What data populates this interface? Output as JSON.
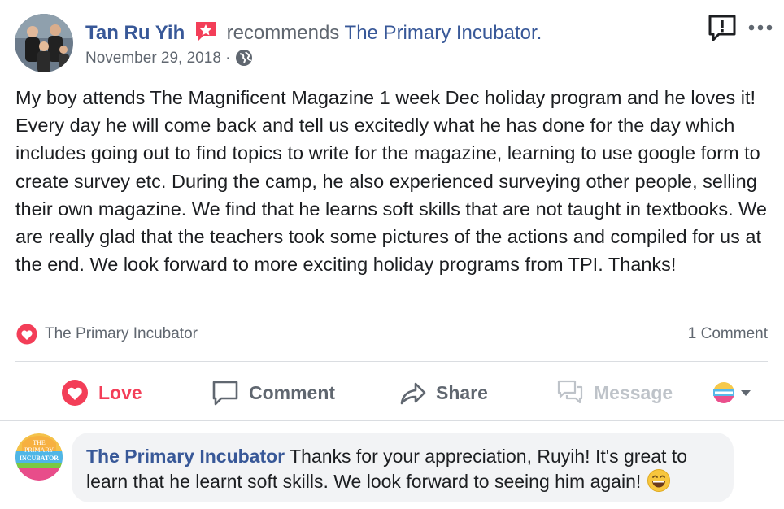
{
  "post": {
    "author_name": "Tan Ru Yih",
    "verb": "recommends",
    "page_name": "The Primary Incubator.",
    "date": "November 29, 2018",
    "date_separator": "·",
    "body": "My boy attends The Magnificent Magazine 1 week Dec holiday program and he loves it! Every day he will come back and tell us excitedly what he has done for the day which includes going out to find topics to write for the magazine, learning to use google form to create survey etc. During the camp, he also experienced surveying other people, selling their own magazine. We find that he learns soft skills that are not taught in textbooks. We are really glad that the teachers took some pictures of the actions and compiled for us at the end. We look forward to more exciting holiday programs from TPI. Thanks!"
  },
  "reactions": {
    "reactor": "The Primary Incubator",
    "comment_count": "1 Comment"
  },
  "actions": {
    "love": "Love",
    "comment": "Comment",
    "share": "Share",
    "message": "Message"
  },
  "comment": {
    "author": "The Primary Incubator",
    "text": " Thanks for your appreciation, Ruyih! It's great to learn that he learnt soft skills. We look forward to seeing him again! ",
    "avatar_text": [
      "THE",
      "PRIMARY",
      "INCUBATOR"
    ]
  },
  "colors": {
    "link_blue": "#385898",
    "love_red": "#f33e58",
    "muted": "#606770",
    "bubble_bg": "#f2f3f5"
  },
  "icons": [
    "report-icon",
    "more-icon",
    "recommend-icon",
    "globe-icon",
    "love-icon",
    "comment-icon",
    "share-icon",
    "message-icon",
    "chevron-down-icon",
    "grin-emoji-icon"
  ]
}
